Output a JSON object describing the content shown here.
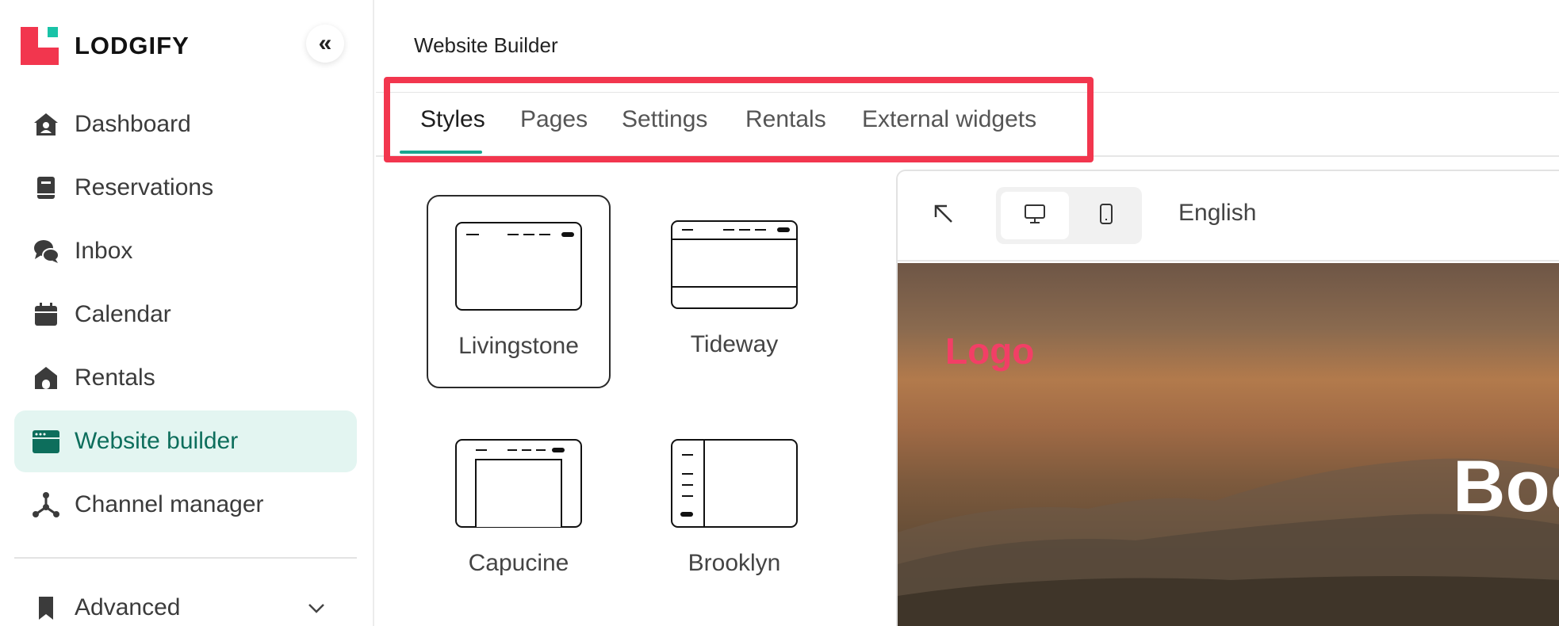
{
  "app": {
    "brand": "LODGIFY",
    "collapse_glyph": "«"
  },
  "sidebar": {
    "items": [
      {
        "label": "Dashboard",
        "icon": "home-user-icon"
      },
      {
        "label": "Reservations",
        "icon": "book-icon"
      },
      {
        "label": "Inbox",
        "icon": "chat-bubbles-icon"
      },
      {
        "label": "Calendar",
        "icon": "calendar-icon"
      },
      {
        "label": "Rentals",
        "icon": "house-icon"
      },
      {
        "label": "Website builder",
        "icon": "browser-window-icon",
        "active": true
      },
      {
        "label": "Channel manager",
        "icon": "network-nodes-icon"
      },
      {
        "label": "Advanced",
        "icon": "bookmark-icon",
        "expandable": true
      }
    ]
  },
  "main": {
    "title": "Website Builder",
    "tabs": [
      {
        "label": "Styles",
        "active": true
      },
      {
        "label": "Pages"
      },
      {
        "label": "Settings"
      },
      {
        "label": "Rentals"
      },
      {
        "label": "External widgets"
      }
    ],
    "styles": [
      {
        "name": "Livingstone",
        "selected": true
      },
      {
        "name": "Tideway"
      },
      {
        "name": "Capucine"
      },
      {
        "name": "Brooklyn"
      }
    ],
    "preview": {
      "language": "English",
      "hero_logo": "Logo",
      "hero_heading_partial": "Boo"
    }
  },
  "colors": {
    "brand_red": "#f2364e",
    "brand_teal": "#19c3a7",
    "active_nav_bg": "#e3f5f1",
    "active_nav_text": "#0d6e5c",
    "tab_indicator": "#19a58f",
    "highlight_box": "#f2364e",
    "hero_logo": "#f23f66"
  }
}
